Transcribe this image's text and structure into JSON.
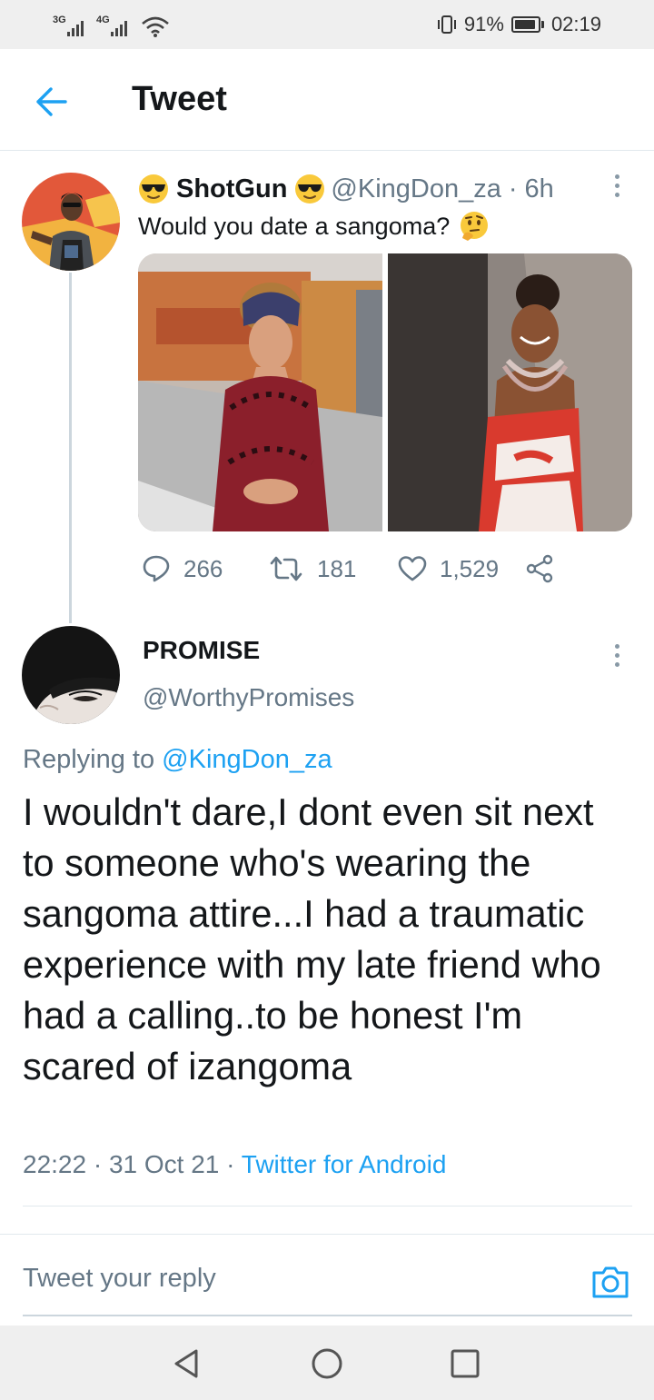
{
  "status_bar": {
    "signal_1_label": "3G",
    "signal_2_label": "4G",
    "battery_percent": "91%",
    "battery_level": 0.91,
    "time": "02:19"
  },
  "header": {
    "title": "Tweet",
    "back_icon": "back-arrow-icon"
  },
  "original_tweet": {
    "author_name": "ShotGun",
    "author_emoji": "sunglasses-face-emoji",
    "handle": "@KingDon_za",
    "separator": "·",
    "time_ago": "6h",
    "text": "Would you date a sangoma?",
    "text_emoji": "thinking-face-emoji",
    "actions": {
      "replies": "266",
      "retweets": "181",
      "likes": "1,529"
    },
    "icons": {
      "reply": "reply-icon",
      "retweet": "retweet-icon",
      "like": "heart-icon",
      "share": "share-icon",
      "more": "more-vertical-icon"
    }
  },
  "reply": {
    "author_name": "PROMISE",
    "handle": "@WorthyPromises",
    "replying_prefix": "Replying to",
    "replying_to": "@KingDon_za",
    "text": "I wouldn't dare,I dont even sit next to someone who's wearing the sangoma attire...I had a traumatic experience with my late friend who had a calling..to be honest I'm scared of izangoma",
    "time": "22:22",
    "date": "31 Oct 21",
    "separator": "·",
    "source": "Twitter for Android"
  },
  "composer": {
    "placeholder": "Tweet your reply",
    "camera_icon": "camera-icon"
  },
  "nav_bar": {
    "back_icon": "triangle-back-icon",
    "home_icon": "circle-home-icon",
    "recents_icon": "square-recents-icon"
  },
  "colors": {
    "accent": "#1da1f2",
    "secondary_text": "#657786",
    "primary_text": "#14171a",
    "divider": "#e1e8ed",
    "system_bar": "#efefef"
  }
}
